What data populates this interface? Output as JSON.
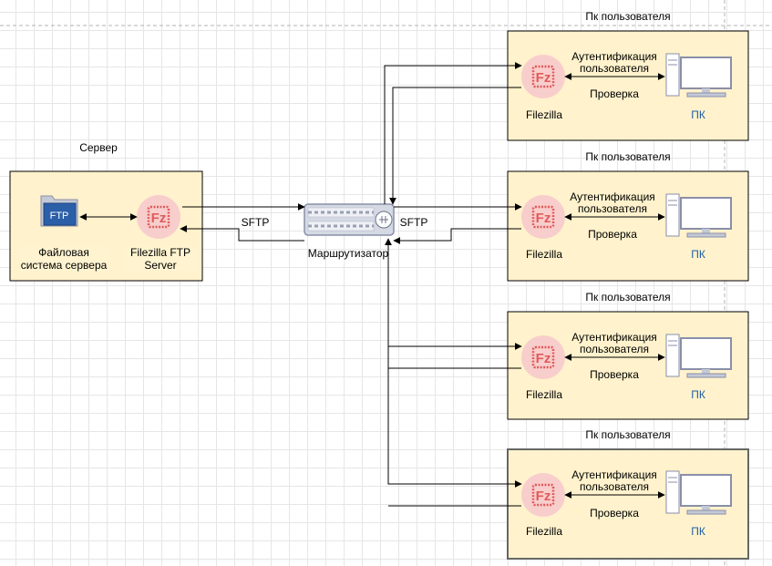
{
  "colors": {
    "box_fill": "#fff2cc",
    "box_stroke": "#000000",
    "line": "#000000",
    "filezilla_bg": "#f8cecc",
    "filezilla_logo": "#e05a5a",
    "pc_fill": "#ffffff",
    "pc_stroke": "#8a8fa8",
    "pc_label": "#1f5fa8",
    "router_fill": "#d5d9e3",
    "ftp_screen": "#2b5fa8"
  },
  "server": {
    "title": "Сервер",
    "fs_label": "Файловая система сервера",
    "ftp_icon_text": "FTP",
    "filezilla_label": "Filezilla FTP Server"
  },
  "router": {
    "label": "Маршрутизатор",
    "sftp_left": "SFTP",
    "sftp_right": "SFTP"
  },
  "user_pcs": [
    {
      "title": "Пк пользователя",
      "auth_label": "Аутентификация пользователя",
      "check_label": "Проверка",
      "client_label": "Filezilla",
      "pc_label": "ПК"
    },
    {
      "title": "Пк пользователя",
      "auth_label": "Аутентификация пользователя",
      "check_label": "Проверка",
      "client_label": "Filezilla",
      "pc_label": "ПК"
    },
    {
      "title": "Пк пользователя",
      "auth_label": "Аутентификация пользователя",
      "check_label": "Проверка",
      "client_label": "Filezilla",
      "pc_label": "ПК"
    },
    {
      "title": "Пк пользователя",
      "auth_label": "Аутентификация пользователя",
      "check_label": "Проверка",
      "client_label": "Filezilla",
      "pc_label": "ПК"
    }
  ]
}
